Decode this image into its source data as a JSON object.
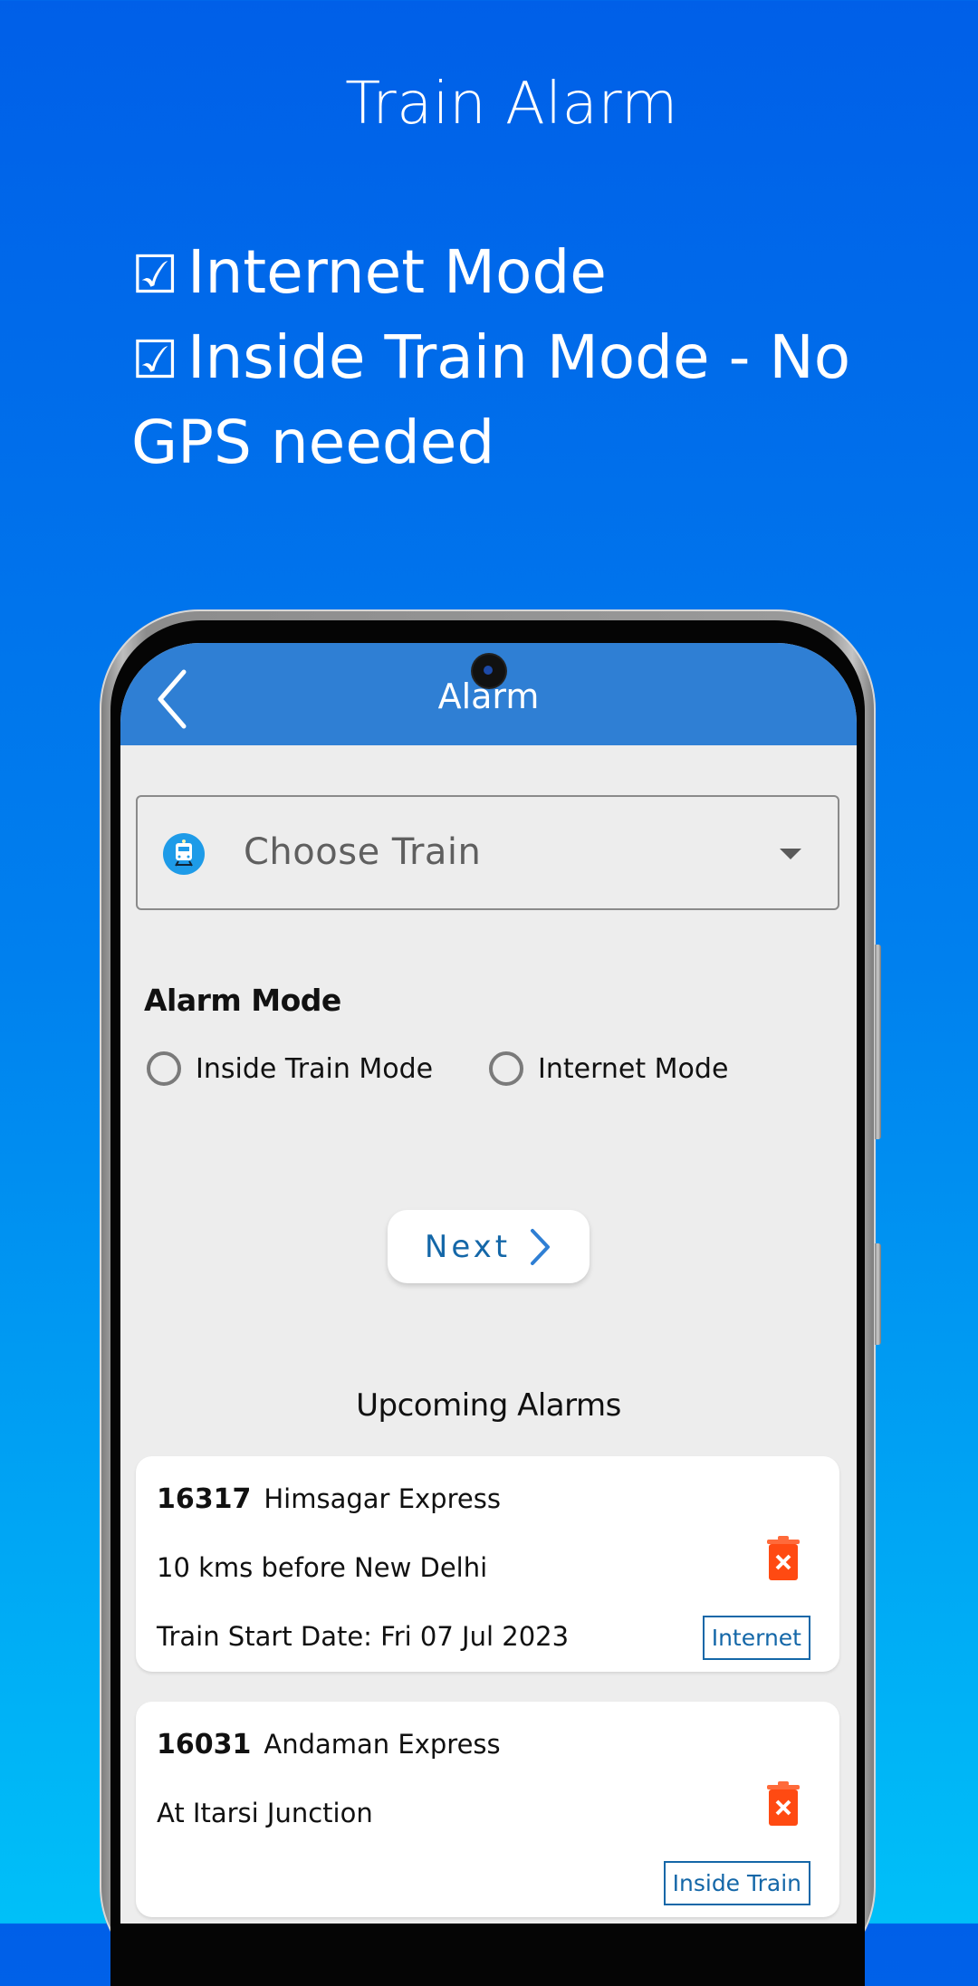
{
  "promo": {
    "title": "Train Alarm",
    "features": [
      {
        "check": "☑",
        "text": "Internet Mode"
      },
      {
        "check": "☑",
        "text": "Inside Train Mode - No GPS needed"
      }
    ]
  },
  "app": {
    "appbar": {
      "back_icon": "chevron-left-icon",
      "title": "Alarm"
    },
    "train_select": {
      "icon": "train-icon",
      "placeholder": "Choose Train",
      "arrow_icon": "caret-down-icon"
    },
    "alarm_mode": {
      "label": "Alarm Mode",
      "options": [
        {
          "label": "Inside Train Mode",
          "selected": false
        },
        {
          "label": "Internet Mode",
          "selected": false
        }
      ]
    },
    "next_button": {
      "label": "Next",
      "icon": "chevron-right-icon"
    },
    "upcoming": {
      "title": "Upcoming Alarms",
      "alarms": [
        {
          "train_no": "16317",
          "train_name": "Himsagar Express",
          "location": "10 kms before New Delhi",
          "start_date": "Train Start Date: Fri 07 Jul 2023",
          "mode": "Internet",
          "delete_icon": "trash-delete-icon"
        },
        {
          "train_no": "16031",
          "train_name": "Andaman Express",
          "location": "At Itarsi Junction",
          "start_date": "",
          "mode": "Inside Train",
          "delete_icon": "trash-delete-icon"
        }
      ]
    }
  },
  "colors": {
    "appbar": "#2f7fd4",
    "accent_text": "#1467a8",
    "delete": "#ff4a12",
    "train_icon": "#1e9be8"
  }
}
